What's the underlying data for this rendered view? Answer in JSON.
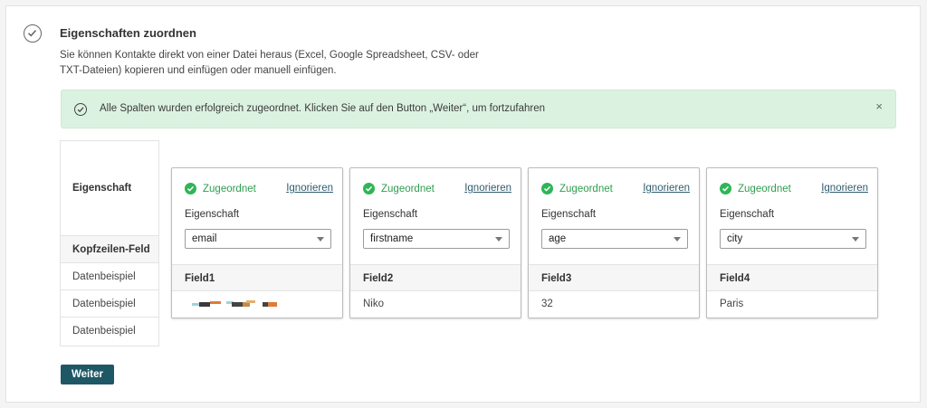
{
  "section": {
    "title": "Eigenschaften zuordnen",
    "description": "Sie können Kontakte direkt von einer Datei heraus (Excel, Google Spreadsheet, CSV- oder TXT-Dateien) kopieren und einfügen oder manuell einfügen."
  },
  "alert": {
    "text": "Alle Spalten wurden erfolgreich zugeordnet. Klicken Sie auf den Button „Weiter“, um fortzufahren",
    "close": "×"
  },
  "labels": {
    "property": "Eigenschaft",
    "header_field": "Kopfzeilen-Feld",
    "sample_1": "Datenbeispiel",
    "sample_2": "Datenbeispiel",
    "sample_3": "Datenbeispiel"
  },
  "columns": [
    {
      "status": "Zugeordnet",
      "ignore": "Ignorieren",
      "prop_label": "Eigenschaft",
      "selected": "email",
      "field": "Field1",
      "sample": ""
    },
    {
      "status": "Zugeordnet",
      "ignore": "Ignorieren",
      "prop_label": "Eigenschaft",
      "selected": "firstname",
      "field": "Field2",
      "sample": "Niko"
    },
    {
      "status": "Zugeordnet",
      "ignore": "Ignorieren",
      "prop_label": "Eigenschaft",
      "selected": "age",
      "field": "Field3",
      "sample": "32"
    },
    {
      "status": "Zugeordnet",
      "ignore": "Ignorieren",
      "prop_label": "Eigenschaft",
      "selected": "city",
      "field": "Field4",
      "sample": "Paris"
    }
  ],
  "next_button": "Weiter",
  "colors": {
    "accent": "#1e5866",
    "success": "#2fb557",
    "alert_bg": "#dcf2e1"
  },
  "icons": {
    "step": "check-circle-icon",
    "alert": "check-circle-icon",
    "status": "check-filled-icon",
    "close": "close-icon",
    "select": "chevron-down-icon"
  }
}
